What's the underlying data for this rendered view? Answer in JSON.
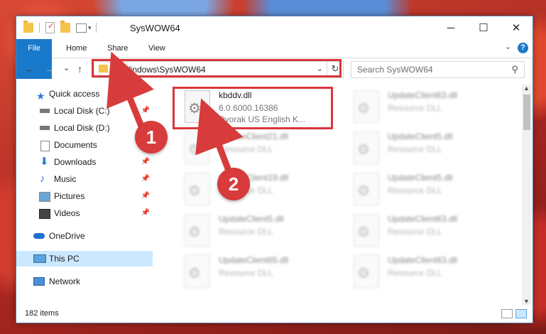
{
  "window": {
    "title": "SysWOW64"
  },
  "window_controls": {
    "minimize": "─",
    "maximize": "☐",
    "close": "✕"
  },
  "ribbon": {
    "tabs": [
      "File",
      "Home",
      "Share",
      "View"
    ],
    "help": "?"
  },
  "address": {
    "path": "C:\\Windows\\SysWOW64",
    "refresh": "↻",
    "dropdown": "⌄"
  },
  "search": {
    "placeholder": "Search SysWOW64"
  },
  "nav_buttons": {
    "back": "←",
    "forward": "→",
    "recent": "⌄",
    "up": "↑"
  },
  "nav": {
    "items": [
      {
        "label": "Quick access",
        "icon": "star-icon",
        "pinned": false
      },
      {
        "label": "Local Disk (C:)",
        "icon": "drive-icon",
        "pinned": true
      },
      {
        "label": "Local Disk (D:)",
        "icon": "drive-icon",
        "pinned": false
      },
      {
        "label": "Documents",
        "icon": "documents-icon",
        "pinned": true
      },
      {
        "label": "Downloads",
        "icon": "downloads-icon",
        "pinned": true
      },
      {
        "label": "Music",
        "icon": "music-icon",
        "pinned": true
      },
      {
        "label": "Pictures",
        "icon": "pictures-icon",
        "pinned": true
      },
      {
        "label": "Videos",
        "icon": "videos-icon",
        "pinned": true
      },
      {
        "label": "OneDrive",
        "icon": "cloud-icon",
        "pinned": false
      },
      {
        "label": "This PC",
        "icon": "computer-icon",
        "pinned": false,
        "selected": true
      },
      {
        "label": "Network",
        "icon": "network-icon",
        "pinned": false
      }
    ]
  },
  "files": {
    "highlighted": {
      "name": "kbddv.dll",
      "version": "6.0.6000.16386",
      "description": "Dvorak US English K..."
    },
    "left_column": [
      {
        "name": "UpdateClient21.dll",
        "type": "Resource DLL"
      },
      {
        "name": "UpdateClient19.dll",
        "type": "Resource DLL"
      },
      {
        "name": "UpdateClient5.dll",
        "type": "Resource DLL"
      },
      {
        "name": "UpdateClient65.dll",
        "type": "Resource DLL"
      }
    ],
    "right_column": [
      {
        "name": "UpdateClient63.dll",
        "type": "Resource DLL"
      },
      {
        "name": "UpdateClient5.dll",
        "type": "Resource DLL"
      },
      {
        "name": "UpdateClient5.dll",
        "type": "Resource DLL"
      },
      {
        "name": "UpdateClient63.dll",
        "type": "Resource DLL"
      },
      {
        "name": "UpdateClient63.dll",
        "type": "Resource DLL"
      }
    ]
  },
  "status": {
    "item_count": "182 items"
  },
  "callouts": [
    "1",
    "2"
  ],
  "colors": {
    "accent": "#1979ca",
    "highlight": "#d9363e",
    "selected": "#cce8ff"
  }
}
